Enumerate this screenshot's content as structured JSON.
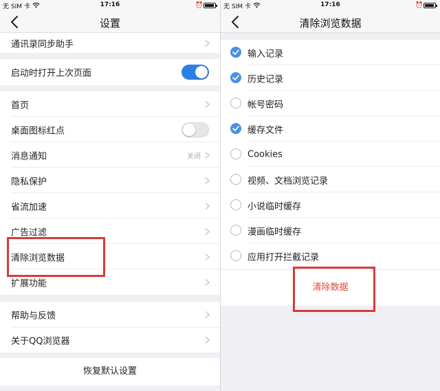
{
  "status_bar": {
    "carrier": "无 SIM 卡",
    "time": "17:16"
  },
  "settings": {
    "title": "设置",
    "items": [
      {
        "label": "通讯录同步助手"
      },
      {
        "label": "启动时打开上次页面",
        "toggle": "on"
      },
      {
        "label": "首页"
      },
      {
        "label": "桌面图标红点",
        "toggle": "off"
      },
      {
        "label": "消息通知",
        "value": "关闭"
      },
      {
        "label": "隐私保护"
      },
      {
        "label": "省流加速"
      },
      {
        "label": "广告过滤"
      },
      {
        "label": "清除浏览数据"
      },
      {
        "label": "扩展功能"
      },
      {
        "label": "帮助与反馈"
      },
      {
        "label": "关于QQ浏览器"
      }
    ],
    "reset_label": "恢复默认设置"
  },
  "clear_data": {
    "title": "清除浏览数据",
    "options": [
      {
        "label": "输入记录",
        "checked": true
      },
      {
        "label": "历史记录",
        "checked": true
      },
      {
        "label": "帐号密码",
        "checked": false
      },
      {
        "label": "缓存文件",
        "checked": true
      },
      {
        "label": "Cookies",
        "checked": false
      },
      {
        "label": "视频、文档浏览记录",
        "checked": false
      },
      {
        "label": "小说临时缓存",
        "checked": false
      },
      {
        "label": "漫画临时缓存",
        "checked": false
      },
      {
        "label": "应用打开拦截记录",
        "checked": false
      }
    ],
    "clear_button": "清除数据"
  },
  "colors": {
    "accent": "#2c7fe5",
    "check": "#4a8fe5",
    "highlight": "#d93a3a",
    "danger": "#e0463c"
  }
}
